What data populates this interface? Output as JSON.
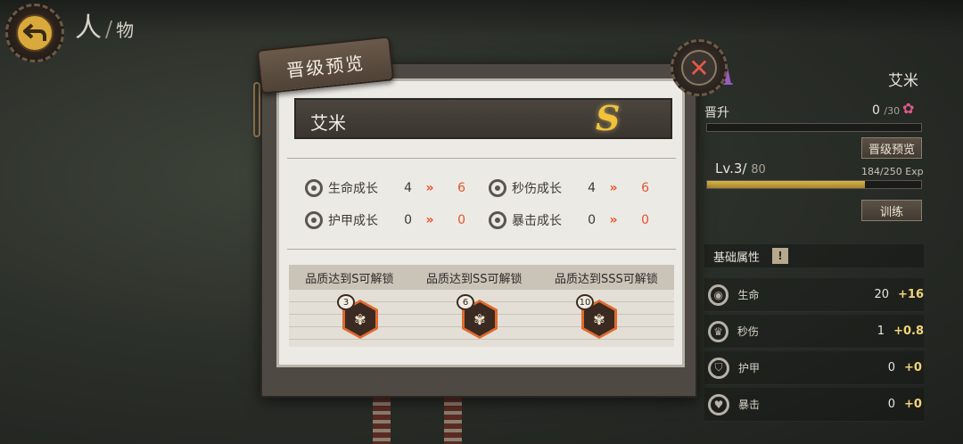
{
  "header": {
    "title_main": "人",
    "title_sub": "物"
  },
  "modal": {
    "tab_label": "晋级预览",
    "character_name": "艾米",
    "rank": "S",
    "stats": [
      {
        "label": "生命成长",
        "from": "4",
        "to": "6"
      },
      {
        "label": "秒伤成长",
        "from": "4",
        "to": "6"
      },
      {
        "label": "护甲成长",
        "from": "0",
        "to": "0"
      },
      {
        "label": "暴击成长",
        "from": "0",
        "to": "0"
      }
    ],
    "arrow_symbol": "»",
    "unlocks": [
      {
        "label": "品质达到S可解锁",
        "level": "3"
      },
      {
        "label": "品质达到SS可解锁",
        "level": "6"
      },
      {
        "label": "品质达到SSS可解锁",
        "level": "10"
      }
    ]
  },
  "panel": {
    "rank_letter": "A",
    "name": "艾米",
    "promotion_label": "晋升",
    "promotion_value": "0",
    "promotion_max": "/30",
    "promotion_progress": 0,
    "preview_button": "晋级预览",
    "level_label": "Lv.3/",
    "level_max": "80",
    "exp_text": "184/250  Exp",
    "exp_progress": 0.736,
    "train_button": "训练",
    "section_title": "基础属性",
    "info_icon": "!",
    "attributes": [
      {
        "label": "生命",
        "value": "20",
        "bonus": "+16",
        "icon": "life-icon"
      },
      {
        "label": "秒伤",
        "value": "1",
        "bonus": "+0.8",
        "icon": "dps-icon"
      },
      {
        "label": "护甲",
        "value": "0",
        "bonus": "+0",
        "icon": "armor-icon"
      },
      {
        "label": "暴击",
        "value": "0",
        "bonus": "+0",
        "icon": "crit-icon"
      }
    ]
  },
  "colors": {
    "accent_orange": "#e0552e",
    "gold": "#f1c23a",
    "exp_bar": "#d8b74a"
  }
}
